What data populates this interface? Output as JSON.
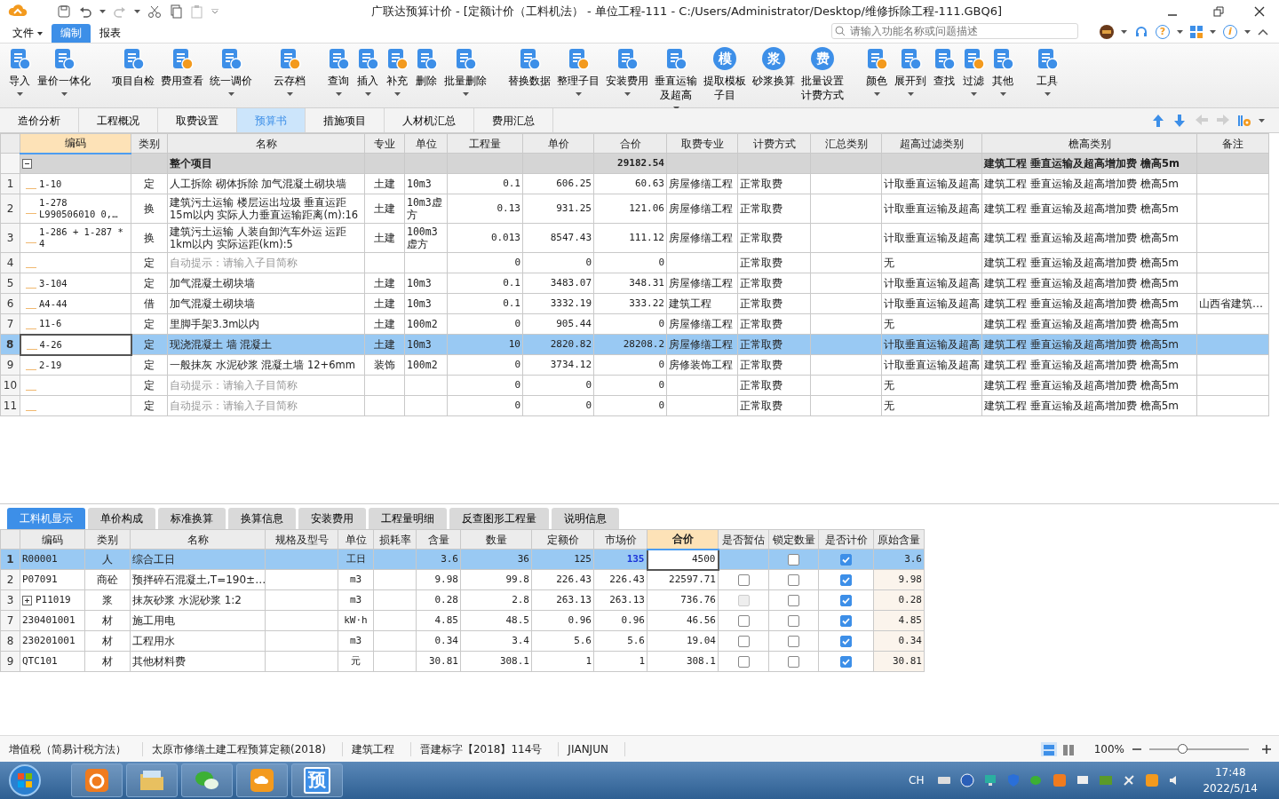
{
  "window": {
    "title": "广联达预算计价 - [定额计价（工料机法） - 单位工程-111 - C:/Users/Administrator/Desktop/维修拆除工程-111.GBQ6]"
  },
  "menu": {
    "items": [
      {
        "label": "文件",
        "dropdown": true,
        "selected": false
      },
      {
        "label": "编制",
        "dropdown": false,
        "selected": true
      },
      {
        "label": "报表",
        "dropdown": false,
        "selected": false
      }
    ],
    "search": {
      "placeholder": "请输入功能名称或问题描述"
    },
    "help_label": "?",
    "info_label": "i"
  },
  "ribbon": {
    "groups": [
      {
        "buttons": [
          {
            "lines": [
              "导入"
            ],
            "dropdown": true
          },
          {
            "lines": [
              "量价一体化"
            ],
            "dropdown": true
          }
        ]
      },
      {
        "buttons": [
          {
            "lines": [
              "项目自检"
            ],
            "dropdown": false
          },
          {
            "lines": [
              "费用查看"
            ],
            "dropdown": false
          },
          {
            "lines": [
              "统一调价"
            ],
            "dropdown": true
          }
        ]
      },
      {
        "buttons": [
          {
            "lines": [
              "云存档"
            ],
            "dropdown": true
          }
        ]
      },
      {
        "buttons": [
          {
            "lines": [
              "查询"
            ],
            "dropdown": true
          },
          {
            "lines": [
              "插入"
            ],
            "dropdown": true
          },
          {
            "lines": [
              "补充"
            ],
            "dropdown": true
          },
          {
            "lines": [
              "删除"
            ],
            "dropdown": false
          },
          {
            "lines": [
              "批量删除"
            ],
            "dropdown": true
          }
        ]
      },
      {
        "buttons": [
          {
            "lines": [
              "替换数据"
            ],
            "dropdown": false
          },
          {
            "lines": [
              "整理子目"
            ],
            "dropdown": true
          },
          {
            "lines": [
              "安装费用"
            ],
            "dropdown": true
          },
          {
            "lines": [
              "垂直运输",
              "及超高"
            ],
            "dropdown": true
          },
          {
            "lines": [
              "提取模板",
              "子目"
            ],
            "dropdown": false,
            "icon_text": "模"
          },
          {
            "lines": [
              "砂浆换算"
            ],
            "dropdown": false,
            "icon_text": "浆"
          },
          {
            "lines": [
              "批量设置",
              "计费方式"
            ],
            "dropdown": false,
            "icon_text": "费"
          }
        ]
      },
      {
        "buttons": [
          {
            "lines": [
              "颜色"
            ],
            "dropdown": true
          },
          {
            "lines": [
              "展开到"
            ],
            "dropdown": true
          },
          {
            "lines": [
              "查找"
            ],
            "dropdown": false
          },
          {
            "lines": [
              "过滤"
            ],
            "dropdown": true
          },
          {
            "lines": [
              "其他"
            ],
            "dropdown": true
          }
        ]
      },
      {
        "buttons": [
          {
            "lines": [
              "工具"
            ],
            "dropdown": true
          }
        ]
      }
    ]
  },
  "view_tabs": [
    {
      "label": "造价分析",
      "selected": false
    },
    {
      "label": "工程概况",
      "selected": false
    },
    {
      "label": "取费设置",
      "selected": false
    },
    {
      "label": "预算书",
      "selected": true
    },
    {
      "label": "措施项目",
      "selected": false
    },
    {
      "label": "人材机汇总",
      "selected": false
    },
    {
      "label": "费用汇总",
      "selected": false
    }
  ],
  "nav_arrows": [
    {
      "kind": "up",
      "enabled": true
    },
    {
      "kind": "down",
      "enabled": true
    },
    {
      "kind": "left",
      "enabled": false
    },
    {
      "kind": "right",
      "enabled": false
    }
  ],
  "budget_table": {
    "columns": [
      {
        "label": "编码",
        "highlighted": true
      },
      {
        "label": "类别",
        "highlighted": false
      },
      {
        "label": "名称",
        "highlighted": false
      },
      {
        "label": "专业",
        "highlighted": false
      },
      {
        "label": "单位",
        "highlighted": false
      },
      {
        "label": "工程量",
        "highlighted": false
      },
      {
        "label": "单价",
        "highlighted": false
      },
      {
        "label": "合价",
        "highlighted": false
      },
      {
        "label": "取费专业",
        "highlighted": false
      },
      {
        "label": "计费方式",
        "highlighted": false
      },
      {
        "label": "汇总类别",
        "highlighted": false
      },
      {
        "label": "超高过滤类别",
        "highlighted": false
      },
      {
        "label": "檐高类别",
        "highlighted": false
      },
      {
        "label": "备注",
        "highlighted": false
      }
    ],
    "group": {
      "name": "整个项目",
      "total": "29182.54",
      "eave_type": "建筑工程 垂直运输及超高增加费 檐高5m",
      "expanded": true
    },
    "rows": [
      {
        "num": "1",
        "code": "1-10",
        "type": "定",
        "name": "人工拆除 砌体拆除 加气混凝土砌块墙",
        "major": "土建",
        "unit": "10m3",
        "quantity": "0.1",
        "unit_price": "606.25",
        "total": "60.63",
        "fee_major": "房屋修缮工程",
        "pricing_method": "正常取费",
        "filter_type": "计取垂直运输及超高",
        "eave_type": "建筑工程 垂直运输及超高增加费 檐高5m",
        "hint": false,
        "selected": false
      },
      {
        "num": "2",
        "code": "1-278\nL990506010 0,…",
        "type": "换",
        "name": "建筑污土运输 楼层运出垃圾 垂直运距\n15m以内  实际人力垂直运输距离(m):16",
        "major": "土建",
        "unit": "10m3虚方",
        "quantity": "0.13",
        "unit_price": "931.25",
        "total": "121.06",
        "fee_major": "房屋修缮工程",
        "pricing_method": "正常取费",
        "filter_type": "计取垂直运输及超高",
        "eave_type": "建筑工程 垂直运输及超高增加费 檐高5m",
        "hint": false,
        "selected": false
      },
      {
        "num": "3",
        "code": "1-286 + 1-287 *\n4",
        "type": "换",
        "name": "建筑污土运输 人装自卸汽车外运 运距\n1km以内  实际运距(km):5",
        "major": "土建",
        "unit": "100m3\n虚方",
        "quantity": "0.013",
        "unit_price": "8547.43",
        "total": "111.12",
        "fee_major": "房屋修缮工程",
        "pricing_method": "正常取费",
        "filter_type": "计取垂直运输及超高",
        "eave_type": "建筑工程 垂直运输及超高增加费 檐高5m",
        "hint": false,
        "selected": false
      },
      {
        "num": "4",
        "type": "定",
        "name": "自动提示：请输入子目简称",
        "quantity": "0",
        "unit_price": "0",
        "total": "0",
        "pricing_method": "正常取费",
        "filter_type": "无",
        "eave_type": "建筑工程 垂直运输及超高增加费 檐高5m",
        "hint": true,
        "selected": false
      },
      {
        "num": "5",
        "code": "3-104",
        "type": "定",
        "name": "加气混凝土砌块墙",
        "major": "土建",
        "unit": "10m3",
        "quantity": "0.1",
        "unit_price": "3483.07",
        "total": "348.31",
        "fee_major": "房屋修缮工程",
        "pricing_method": "正常取费",
        "filter_type": "计取垂直运输及超高",
        "eave_type": "建筑工程 垂直运输及超高增加费 檐高5m",
        "hint": false,
        "selected": false
      },
      {
        "num": "6",
        "code": "A4-44",
        "type": "借",
        "name": "加气混凝土砌块墙",
        "major": "土建",
        "unit": "10m3",
        "quantity": "0.1",
        "unit_price": "3332.19",
        "total": "333.22",
        "fee_major": "建筑工程",
        "pricing_method": "正常取费",
        "filter_type": "计取垂直运输及超高",
        "eave_type": "建筑工程 垂直运输及超高增加费 檐高5m",
        "note": "山西省建筑…",
        "hint": false,
        "selected": false
      },
      {
        "num": "7",
        "code": "11-6",
        "type": "定",
        "name": "里脚手架3.3m以内",
        "major": "土建",
        "unit": "100m2",
        "quantity": "0",
        "unit_price": "905.44",
        "total": "0",
        "fee_major": "房屋修缮工程",
        "pricing_method": "正常取费",
        "filter_type": "无",
        "eave_type": "建筑工程 垂直运输及超高增加费 檐高5m",
        "hint": false,
        "selected": false
      },
      {
        "num": "8",
        "code": "4-26",
        "type": "定",
        "name": "现浇混凝土 墙 混凝土",
        "major": "土建",
        "unit": "10m3",
        "quantity": "10",
        "unit_price": "2820.82",
        "total": "28208.2",
        "fee_major": "房屋修缮工程",
        "pricing_method": "正常取费",
        "filter_type": "计取垂直运输及超高",
        "eave_type": "建筑工程 垂直运输及超高增加费 檐高5m",
        "hint": false,
        "selected": true
      },
      {
        "num": "9",
        "code": "2-19",
        "type": "定",
        "name": "一般抹灰 水泥砂浆 混凝土墙 12+6mm",
        "major": "装饰",
        "unit": "100m2",
        "quantity": "0",
        "unit_price": "3734.12",
        "total": "0",
        "fee_major": "房修装饰工程",
        "pricing_method": "正常取费",
        "filter_type": "计取垂直运输及超高",
        "eave_type": "建筑工程 垂直运输及超高增加费 檐高5m",
        "hint": false,
        "selected": false
      },
      {
        "num": "10",
        "type": "定",
        "name": "自动提示：请输入子目简称",
        "quantity": "0",
        "unit_price": "0",
        "total": "0",
        "pricing_method": "正常取费",
        "filter_type": "无",
        "eave_type": "建筑工程 垂直运输及超高增加费 檐高5m",
        "hint": true,
        "selected": false
      },
      {
        "num": "11",
        "type": "定",
        "name": "自动提示：请输入子目简称",
        "quantity": "0",
        "unit_price": "0",
        "total": "0",
        "pricing_method": "正常取费",
        "filter_type": "无",
        "eave_type": "建筑工程 垂直运输及超高增加费 檐高5m",
        "hint": true,
        "selected": false
      }
    ]
  },
  "detail_tabs": [
    {
      "label": "工料机显示",
      "selected": true
    },
    {
      "label": "单价构成",
      "selected": false
    },
    {
      "label": "标准换算",
      "selected": false
    },
    {
      "label": "换算信息",
      "selected": false
    },
    {
      "label": "安装费用",
      "selected": false
    },
    {
      "label": "工程量明细",
      "selected": false
    },
    {
      "label": "反查图形工程量",
      "selected": false
    },
    {
      "label": "说明信息",
      "selected": false
    }
  ],
  "resource_table": {
    "columns": [
      {
        "label": "编码",
        "highlighted": false
      },
      {
        "label": "类别",
        "highlighted": false
      },
      {
        "label": "名称",
        "highlighted": false
      },
      {
        "label": "规格及型号",
        "highlighted": false
      },
      {
        "label": "单位",
        "highlighted": false
      },
      {
        "label": "损耗率",
        "highlighted": false
      },
      {
        "label": "含量",
        "highlighted": false
      },
      {
        "label": "数量",
        "highlighted": false
      },
      {
        "label": "定额价",
        "highlighted": false
      },
      {
        "label": "市场价",
        "highlighted": false
      },
      {
        "label": "合价",
        "highlighted": true
      },
      {
        "label": "是否暂估",
        "highlighted": false
      },
      {
        "label": "锁定数量",
        "highlighted": false
      },
      {
        "label": "是否计价",
        "highlighted": false
      },
      {
        "label": "原始含量",
        "highlighted": false
      }
    ],
    "rows": [
      {
        "num": "1",
        "code": "R00001",
        "type": "人",
        "name": "综合工日",
        "unit": "工日",
        "content": "3.6",
        "quantity": "36",
        "quota_price": "125",
        "market_price": "135",
        "price_changed": true,
        "total": "4500",
        "locked": {
          "checked": false,
          "disabled": false
        },
        "counted": {
          "checked": true,
          "disabled": false
        },
        "original_content": "3.6",
        "expandable": false,
        "selected": true
      },
      {
        "num": "2",
        "code": "P07091",
        "type": "商砼",
        "name": "预拌碎石混凝土,T=190±…",
        "unit": "m3",
        "content": "9.98",
        "quantity": "99.8",
        "quota_price": "226.43",
        "market_price": "226.43",
        "price_changed": false,
        "total": "22597.71",
        "provisional": {
          "checked": false,
          "disabled": false
        },
        "locked": {
          "checked": false,
          "disabled": false
        },
        "counted": {
          "checked": true,
          "disabled": false
        },
        "original_content": "9.98",
        "expandable": false,
        "selected": false
      },
      {
        "num": "3",
        "code": "P11019",
        "type": "浆",
        "name": "抹灰砂浆 水泥砂浆 1:2",
        "unit": "m3",
        "content": "0.28",
        "quantity": "2.8",
        "quota_price": "263.13",
        "market_price": "263.13",
        "price_changed": false,
        "total": "736.76",
        "provisional": {
          "checked": false,
          "disabled": true
        },
        "locked": {
          "checked": false,
          "disabled": false
        },
        "counted": {
          "checked": true,
          "disabled": false
        },
        "original_content": "0.28",
        "expandable": true,
        "expanded": false,
        "selected": false
      },
      {
        "num": "7",
        "code": "230401001",
        "type": "材",
        "name": "施工用电",
        "unit": "kW·h",
        "content": "4.85",
        "quantity": "48.5",
        "quota_price": "0.96",
        "market_price": "0.96",
        "price_changed": false,
        "total": "46.56",
        "provisional": {
          "checked": false,
          "disabled": false
        },
        "locked": {
          "checked": false,
          "disabled": false
        },
        "counted": {
          "checked": true,
          "disabled": false
        },
        "original_content": "4.85",
        "expandable": false,
        "selected": false
      },
      {
        "num": "8",
        "code": "230201001",
        "type": "材",
        "name": "工程用水",
        "unit": "m3",
        "content": "0.34",
        "quantity": "3.4",
        "quota_price": "5.6",
        "market_price": "5.6",
        "price_changed": false,
        "total": "19.04",
        "provisional": {
          "checked": false,
          "disabled": false
        },
        "locked": {
          "checked": false,
          "disabled": false
        },
        "counted": {
          "checked": true,
          "disabled": false
        },
        "original_content": "0.34",
        "expandable": false,
        "selected": false
      },
      {
        "num": "9",
        "code": "QTC101",
        "type": "材",
        "name": "其他材料费",
        "unit": "元",
        "content": "30.81",
        "quantity": "308.1",
        "quota_price": "1",
        "market_price": "1",
        "price_changed": false,
        "total": "308.1",
        "provisional": {
          "checked": false,
          "disabled": false
        },
        "locked": {
          "checked": false,
          "disabled": false
        },
        "counted": {
          "checked": true,
          "disabled": false
        },
        "original_content": "30.81",
        "expandable": false,
        "selected": false
      }
    ]
  },
  "status_bar": {
    "items": [
      "增值税（简易计税方法）",
      "太原市修缮土建工程预算定额(2018)",
      "建筑工程",
      "晋建标字【2018】114号",
      "JIANJUN"
    ],
    "layouts": [
      {
        "kind": "rows",
        "selected": true
      },
      {
        "kind": "columns",
        "selected": false
      }
    ],
    "zoom": "100%",
    "zoom_slider": {
      "level": 0.33
    }
  },
  "taskbar": {
    "apps": [
      {
        "kind": "browser"
      },
      {
        "kind": "folder"
      },
      {
        "kind": "chat"
      },
      {
        "kind": "logo"
      },
      {
        "kind": "text",
        "label": "预"
      }
    ],
    "input_method": "CH",
    "time": "17:48",
    "date": "2022/5/14"
  }
}
